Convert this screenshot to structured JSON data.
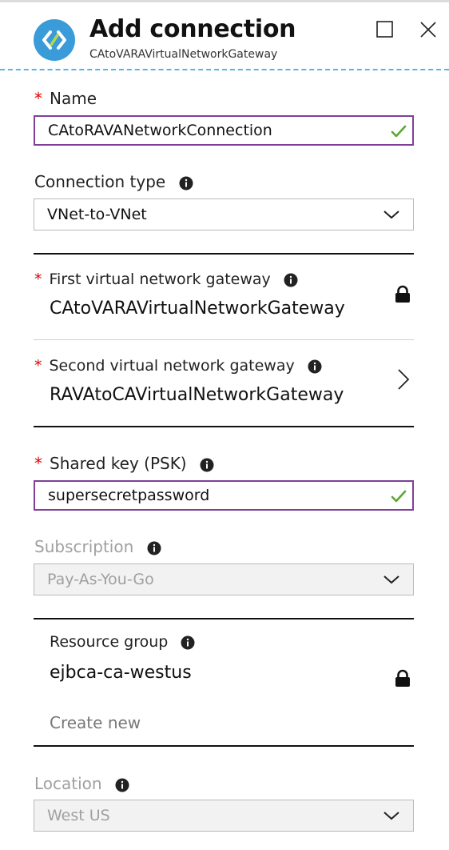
{
  "header": {
    "title": "Add connection",
    "subtitle": "CAtoVARAVirtualNetworkGateway",
    "maximize_icon": "maximize-icon",
    "close_icon": "close-icon"
  },
  "form": {
    "name": {
      "label": "Name",
      "required_mark": "*",
      "value": "CAtoRAVANetworkConnection"
    },
    "connection_type": {
      "label": "Connection type",
      "value": "VNet-to-VNet"
    },
    "first_gateway": {
      "label": "First virtual network gateway",
      "required_mark": "*",
      "value": "CAtoVARAVirtualNetworkGateway"
    },
    "second_gateway": {
      "label": "Second virtual network gateway",
      "required_mark": "*",
      "value": "RAVAtoCAVirtualNetworkGateway"
    },
    "shared_key": {
      "label": "Shared key (PSK)",
      "required_mark": "*",
      "value": "supersecretpassword"
    },
    "subscription": {
      "label": "Subscription",
      "value": "Pay-As-You-Go"
    },
    "resource_group": {
      "label": "Resource group",
      "value": "ejbca-ca-westus",
      "create_new": "Create new"
    },
    "location": {
      "label": "Location",
      "value": "West US"
    }
  },
  "colors": {
    "accent_border": "#7f3f98",
    "valid_check": "#5aa832",
    "required_star": "#e00000",
    "header_dash": "#59b4e6",
    "disabled_text": "#a0a0a0"
  }
}
